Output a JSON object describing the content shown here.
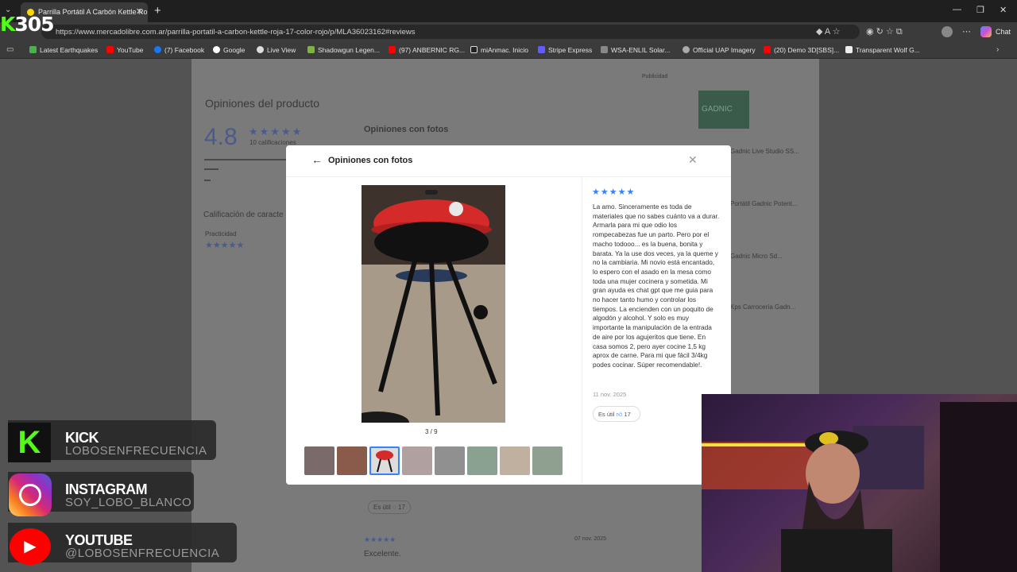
{
  "browser": {
    "tab_title": "Parrilla Portátil A Carbón Kettle Ro",
    "url": "https://www.mercadolibre.com.ar/parrilla-portatil-a-carbon-kettle-roja-17-color-rojo/p/MLA36023162#reviews",
    "chat_label": "Chat",
    "bookmarks": [
      "Latest Earthquakes",
      "YouTube",
      "(7) Facebook",
      "Google",
      "Live View",
      "Shadowgun Legen...",
      "(97) ANBERNIC RG...",
      "miAnmac. Inicio",
      "Stripe Express",
      "WSA-ENLIL Solar...",
      "Official UAP Imagery",
      "(20) Demo 3D[SBS]...",
      "Transparent Wolf G..."
    ]
  },
  "overlay_logo": "305",
  "page": {
    "section_title": "Opiniones del producto",
    "rating": "4.8",
    "ratings_count": "10 calificaciones",
    "photos_heading": "Opiniones con fotos",
    "features_heading": "Calificación de caracte",
    "practicidad": "Practicidad",
    "ad_label": "Publicidad",
    "brand": "GADNIC",
    "sidebar_items": [
      "Gadnic Live Studio SS...",
      "Portátil Gadnic Potent...",
      "Gadnic Micro Sd...",
      "Kps Carrocería Gadn..."
    ],
    "helpful_bg": "Es útil",
    "helpful_bg_count": "17",
    "review2_date": "07 nov. 2025",
    "review2_text": "Excelente."
  },
  "modal": {
    "title": "Opiniones con fotos",
    "counter": "3 / 9",
    "rating_stars": "★★★★★",
    "review_text": "La amo. Sinceramente es toda de materiales que no sabes cuánto va a durar. Armarla para mi que odio los rompecabezas fue un parto. Pero por el macho todooo... es la buena, bonita y barata. Ya la use dos veces, ya la queme y no la cambiaria. Mi novio está encantado, lo espero con el asado en la mesa como toda una mujer cocinera y sometida. Mi gran ayuda es chat gpt que me guia para no hacer tanto humo y controlar los tiempos. La encienden con un poquito de algodón y alcohol. Y solo es muy importante la manipulación de la entrada de aire por los agujeritos que tiene. En casa somos 2, pero ayer cocine 1,5 kg aprox de carne. Para mi que fácil 3/4kg podes cocinar. Súper recomendable!.",
    "date": "11 nov. 2025",
    "helpful_label": "Es útil",
    "helpful_count": "17",
    "thumbnail_count": 8,
    "selected_thumbnail": 3
  },
  "social": [
    {
      "title": "KICK",
      "handle": "LOBOSENFRECUENCIA"
    },
    {
      "title": "INSTAGRAM",
      "handle": "SOY_LOBO_BLANCO"
    },
    {
      "title": "YOUTUBE",
      "handle": "@LOBOSENFRECUENCIA"
    }
  ],
  "colors": {
    "accent": "#3483fa",
    "kick_green": "#53fc18"
  }
}
